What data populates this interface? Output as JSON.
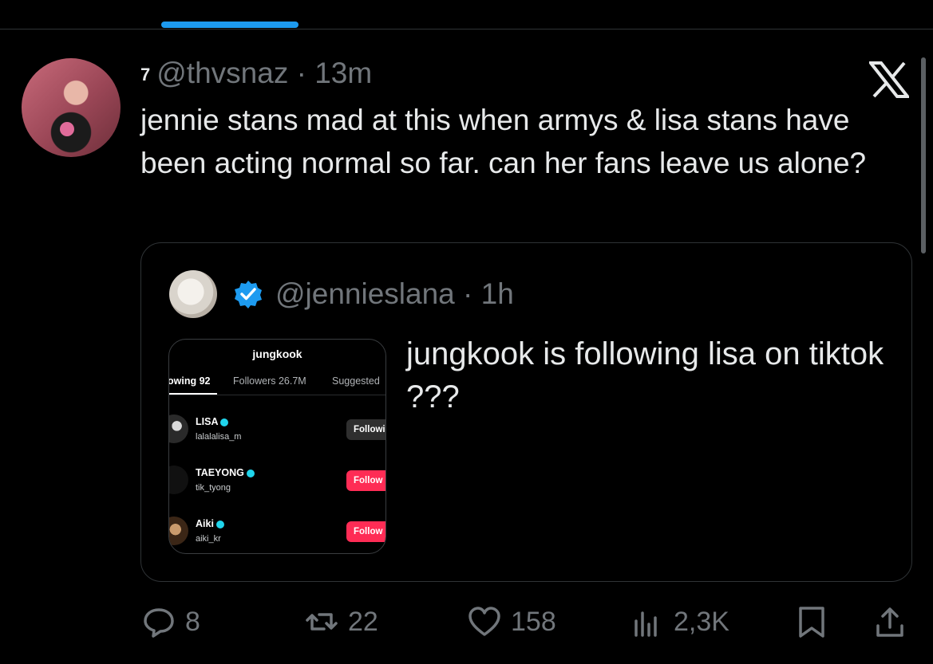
{
  "tweet": {
    "badge": "7",
    "handle": "@thvsnaz",
    "separator": " · ",
    "time": "13m",
    "text": "jennie stans mad at this when armys & lisa stans have been acting normal so far. can her fans leave us alone?"
  },
  "quote": {
    "handle": "@jennieslana",
    "separator": " · ",
    "time": "1h",
    "text": "jungkook is following lisa on tiktok ???",
    "screenshot": {
      "title": "jungkook",
      "tabs": [
        "owing 92",
        "Followers 26.7M",
        "Suggested"
      ],
      "rows": [
        {
          "name": "LISA",
          "handle": "lalalalisa_m",
          "button": "Followi",
          "button_style": "following"
        },
        {
          "name": "TAEYONG",
          "handle": "tik_tyong",
          "button": "Follow",
          "button_style": "follow"
        },
        {
          "name": "Aiki",
          "handle": "aiki_kr",
          "button": "Follow",
          "button_style": "follow"
        }
      ]
    }
  },
  "actions": {
    "reply_count": "8",
    "retweet_count": "22",
    "like_count": "158",
    "views_count": "2,3K"
  },
  "colors": {
    "background": "#000000",
    "text": "#e7e9ea",
    "muted": "#71767b",
    "accent": "#1d9bf0",
    "tiktok_follow": "#fe2c55"
  },
  "icons": [
    "x-logo-icon",
    "verified-badge-icon",
    "reply-icon",
    "retweet-icon",
    "like-icon",
    "views-icon",
    "bookmark-icon",
    "share-icon"
  ]
}
